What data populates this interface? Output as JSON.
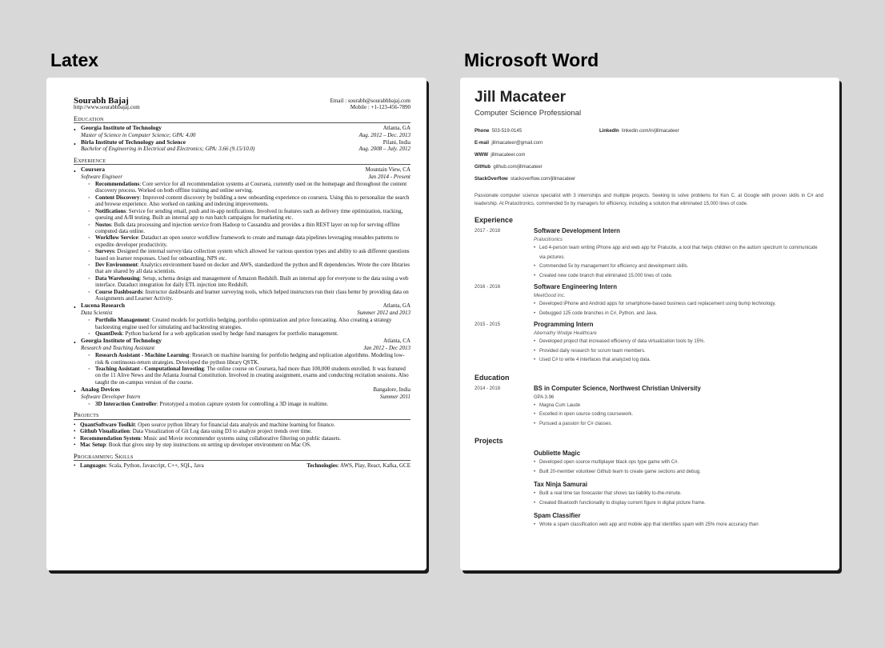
{
  "headings": {
    "latex": "Latex",
    "word": "Microsoft Word"
  },
  "latex": {
    "name": "Sourabh Bajaj",
    "url": "http://www.sourabhbajaj.com",
    "email": "Email : sourabh@sourabhbajaj.com",
    "mobile": "Mobile : +1-123-456-7890",
    "sections": {
      "education": "Education",
      "experience": "Experience",
      "projects": "Projects",
      "skills": "Programming Skills"
    },
    "education": [
      {
        "org": "Georgia Institute of Technology",
        "loc": "Atlanta, GA",
        "degree": "Master of Science in Computer Science; GPA: 4.00",
        "dates": "Aug. 2012 – Dec. 2013"
      },
      {
        "org": "Birla Institute of Technology and Science",
        "loc": "Pilani, India",
        "degree": "Bachelor of Engineering in Electrical and Electronics; GPA: 3.66 (9.15/10.0)",
        "dates": "Aug. 2008 – July. 2012"
      }
    ],
    "experience": [
      {
        "org": "Coursera",
        "loc": "Mountain View, CA",
        "role": "Software Engineer",
        "dates": "Jan 2014 - Present",
        "items": [
          {
            "title": "Recommendations",
            "text": ": Core service for all recommendation systems at Coursera, currently used on the homepage and throughout the content discovery process. Worked on both offline training and online serving."
          },
          {
            "title": "Content Discovery",
            "text": ": Improved content discovery by building a new onboarding experience on coursera. Using this to personalize the search and browse experience. Also worked on ranking and indexing improvements."
          },
          {
            "title": "Notifications",
            "text": ": Service for sending email, push and in-app notifications. Involved in features such as delivery time optimization, tracking, queuing and A/B testing. Built an internal app to run batch campaigns for marketing etc."
          },
          {
            "title": "Nostos",
            "text": ": Bulk data processing and injection service from Hadoop to Cassandra and provides a thin REST layer on top for serving offline computed data online."
          },
          {
            "title": "Workflow Service",
            "text": ": Dataduct an open source workflow framework to create and manage data pipelines leveraging reusables patterns to expedite developer productivity."
          },
          {
            "title": "Surveys",
            "text": ": Designed the internal survey/data collection system which allowed for various question types and ability to ask different questions based on learner responses. Used for onboarding, NPS etc."
          },
          {
            "title": "Dev Environment",
            "text": ": Analytics environment based on docker and AWS, standardized the python and R dependencies. Wrote the core libraries that are shared by all data scientists."
          },
          {
            "title": "Data Warehousing",
            "text": ": Setup, schema design and management of Amazon Redshift. Built an internal app for everyone to the data using a web interface. Dataduct integration for daily ETL injection into Redshift."
          },
          {
            "title": "Course Dashboards",
            "text": ": Instructor dashboards and learner surveying tools, which helped instructors run their class better by providing data on Assignments and Learner Activity."
          }
        ]
      },
      {
        "org": "Lucena Research",
        "loc": "Atlanta, GA",
        "role": "Data Scientist",
        "dates": "Summer 2012 and 2013",
        "items": [
          {
            "title": "Portfolio Management",
            "text": ": Created models for portfolio hedging, portfolio optimization and price forecasting. Also creating a strategy backtesting engine used for simulating and backtesting strategies."
          },
          {
            "title": "QuantDesk",
            "text": ": Python backend for a web application used by hedge fund managers for portfolio management."
          }
        ]
      },
      {
        "org": "Georgia Institute of Technology",
        "loc": "Atlanta, CA",
        "role": "Research and Teaching Assistant",
        "dates": "Jan 2012 - Dec 2013",
        "items": [
          {
            "title": "Research Assistant - Machine Learning",
            "text": ": Research on machine learning for portfolio hedging and replication algorithms. Modeling low-risk & continuous-return strategies. Developed the python library QSTK."
          },
          {
            "title": "Teaching Assistant - Computational Investing",
            "text": ": The online course on Coursera, had more than 100,000 students enrolled. It was featured on the 11 Alive News and the Atlanta Journal Constitution. Involved in creating assignment, exams and conducting recitation sessions. Also taught the on-campus version of the course."
          }
        ]
      },
      {
        "org": "Analog Devices",
        "loc": "Bangalore, India",
        "role": "Software Developer Intern",
        "dates": "Summer 2011",
        "items": [
          {
            "title": "3D Interaction Controller",
            "text": ": Prototyped a motion capture system for controlling a 3D image in realtime."
          }
        ]
      }
    ],
    "projects": [
      {
        "title": "QuantSoftware Toolkit",
        "text": ": Open source python library for financial data analysis and machine learning for finance."
      },
      {
        "title": "Github Visualization",
        "text": ": Data Visualization of Git Log data using D3 to analyze project trends over time."
      },
      {
        "title": "Recommendation System",
        "text": ": Music and Movie recommender systems using collaborative filtering on public datasets."
      },
      {
        "title": "Mac Setup",
        "text": ": Book that gives step by step instructions on setting up developer environment on Mac OS."
      }
    ],
    "skills": {
      "lang_title": "Languages",
      "lang_text": ": Scala, Python, Javascript, C++, SQL, Java",
      "tech_title": "Technologies",
      "tech_text": ": AWS, Play, React, Kafka, GCE"
    }
  },
  "word": {
    "name": "Jill Macateer",
    "title": "Computer Science Professional",
    "contacts": [
      {
        "label": "Phone",
        "value": "503-519-0145"
      },
      {
        "label": "LinkedIn",
        "value": "linkedin.com/in/jillmacateer"
      },
      {
        "label": "E-mail",
        "value": "jillmacateer@gmail.com"
      },
      {
        "label": "",
        "value": ""
      },
      {
        "label": "WWW",
        "value": "jillmacateer.com"
      },
      {
        "label": "",
        "value": ""
      },
      {
        "label": "GitHub",
        "value": "github.com/jillmacateer"
      },
      {
        "label": "",
        "value": ""
      },
      {
        "label": "StackOverflow",
        "value": "stackoverflow.com/jillmacateer"
      },
      {
        "label": "",
        "value": ""
      }
    ],
    "summary": "Passionate computer science specialist with 3 internships and multiple projects. Seeking to solve problems for Ken C. at Google with proven skills in C# and leadership. At Pralucitronics, commended 5x by managers for efficiency, including a solution that eliminated 15,000 lines of code.",
    "sections": {
      "experience": "Experience",
      "education": "Education",
      "projects": "Projects"
    },
    "experience": [
      {
        "date": "2017 - 2018",
        "role": "Software Development Intern",
        "company": "Pralucitronics",
        "bullets": [
          "Led 4-person team writing iPhone app and web app for Pralucite, a tool that helps children on the autism spectrum to communicate via pictures.",
          "Commended 5x by management for efficiency and development skills.",
          "Created new code branch that eliminated 15,000 lines of code."
        ]
      },
      {
        "date": "2016 - 2016",
        "role": "Software Engineering Intern",
        "company": "MeetGood Inc.",
        "bullets": [
          "Developed iPhone and Android apps for smartphone-based business card replacement using bump technology.",
          "Debugged 125 code branches in C#, Python, and Java."
        ]
      },
      {
        "date": "2015 - 2015",
        "role": "Programming Intern",
        "company": "Abernathy Wodge Healthcare",
        "bullets": [
          "Developed project that increased efficiency of data virtualization tools by 15%.",
          "Provided daily research for scrum team members.",
          "Used C# to write 4 interfaces that analyzed log data."
        ]
      }
    ],
    "education": [
      {
        "date": "2014 - 2018",
        "degree": "BS in Computer Science, Northwest Christian University",
        "gpa": "GPA 3.96",
        "bullets": [
          "Magna Cum Laude",
          "Excelled in open source coding coursework.",
          "Pursued a passion for C# classes."
        ]
      }
    ],
    "projects": [
      {
        "name": "Oubliette Magic",
        "bullets": [
          "Developed open source multiplayer black ops type game with C#.",
          "Built 20-member volunteer Github team to create game sections and debug."
        ]
      },
      {
        "name": "Tax Ninja Samurai",
        "bullets": [
          "Built a real time tax forecaster that shows tax liability to-the-minute.",
          "Created Bluetooth functionality to display current figure in digital picture frame."
        ]
      },
      {
        "name": "Spam Classifier",
        "bullets": [
          "Wrote a spam classification web app and mobile app that identifies spam with 25% more accuracy than"
        ]
      }
    ]
  }
}
